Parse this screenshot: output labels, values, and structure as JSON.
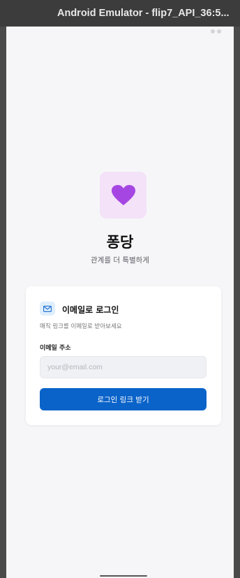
{
  "window": {
    "title": "Android Emulator - flip7_API_36:5..."
  },
  "app": {
    "name": "퐁당",
    "tagline": "관계를 더 특별하게",
    "logo_icon": "heart-icon",
    "logo_color": "#a646e2",
    "logo_bg": "#f3e2f8"
  },
  "login_card": {
    "title": "이메일로 로그인",
    "description": "매직 링크를 이메일로 받아보세요",
    "email_label": "이메일 주소",
    "email_value": "",
    "email_placeholder": "your@email.com",
    "submit_label": "로그인 링크 받기",
    "mail_icon": "mail-icon",
    "accent_color": "#0a63c9"
  }
}
